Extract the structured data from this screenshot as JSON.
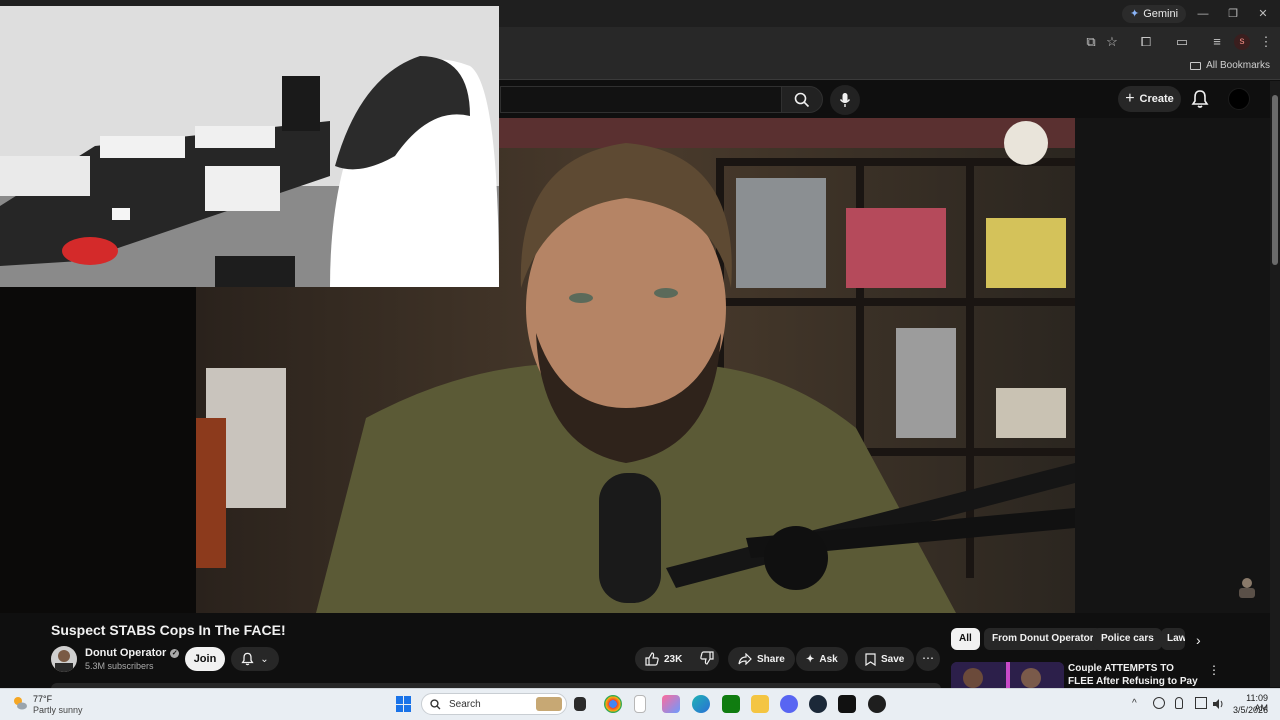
{
  "browser": {
    "gemini_label": "Gemini",
    "bookmarks_label": "All Bookmarks",
    "profile_initial": "s"
  },
  "youtube": {
    "create_label": "Create"
  },
  "video": {
    "title": "Suspect STABS Cops In The FACE!",
    "channel_name": "Donut Operator",
    "subscribers": "5.3M subscribers",
    "join_label": "Join",
    "like_count": "23K",
    "share_label": "Share",
    "ask_label": "Ask",
    "save_label": "Save"
  },
  "chips": [
    {
      "label": "All",
      "selected": true
    },
    {
      "label": "From Donut Operator",
      "selected": false
    },
    {
      "label": "Police cars",
      "selected": false
    },
    {
      "label": "Law",
      "selected": false
    }
  ],
  "recommendation": {
    "title": "Couple ATTEMPTS TO FLEE After Refusing to Pay ..."
  },
  "taskbar": {
    "weather_temp": "77°F",
    "weather_desc": "Partly sunny",
    "search_label": "Search",
    "time": "11:09 AM",
    "date": "3/5/2026"
  },
  "colors": {
    "page_bg": "#0f0f0f",
    "accent_red": "#ff0000",
    "taskbar_bg": "#e9eef3"
  }
}
